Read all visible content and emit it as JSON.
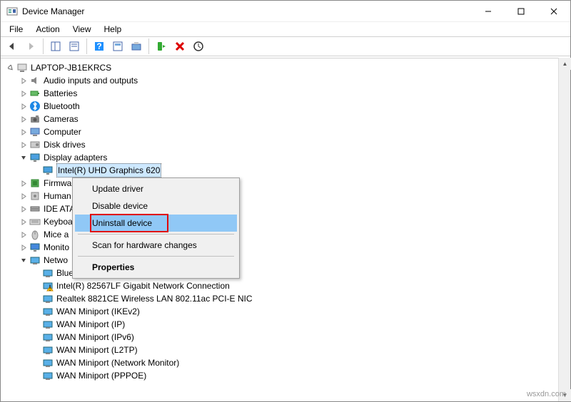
{
  "window": {
    "title": "Device Manager"
  },
  "menubar": [
    "File",
    "Action",
    "View",
    "Help"
  ],
  "tree": {
    "root": "LAPTOP-JB1EKRCS",
    "items": [
      {
        "label": "Audio inputs and outputs",
        "expand": "closed",
        "indent": 1,
        "icon": "audio"
      },
      {
        "label": "Batteries",
        "expand": "closed",
        "indent": 1,
        "icon": "battery"
      },
      {
        "label": "Bluetooth",
        "expand": "closed",
        "indent": 1,
        "icon": "bt"
      },
      {
        "label": "Cameras",
        "expand": "closed",
        "indent": 1,
        "icon": "camera"
      },
      {
        "label": "Computer",
        "expand": "closed",
        "indent": 1,
        "icon": "computer"
      },
      {
        "label": "Disk drives",
        "expand": "closed",
        "indent": 1,
        "icon": "disk"
      },
      {
        "label": "Display adapters",
        "expand": "open",
        "indent": 1,
        "icon": "display"
      },
      {
        "label": "Intel(R) UHD Graphics 620",
        "expand": "none",
        "indent": 2,
        "icon": "display",
        "sel": true
      },
      {
        "label": "Firmwa",
        "expand": "closed",
        "indent": 1,
        "icon": "firmware",
        "trunc": true
      },
      {
        "label": "Human",
        "expand": "closed",
        "indent": 1,
        "icon": "hid",
        "trunc": true
      },
      {
        "label": "IDE ATA",
        "expand": "closed",
        "indent": 1,
        "icon": "ide",
        "trunc": true
      },
      {
        "label": "Keyboa",
        "expand": "closed",
        "indent": 1,
        "icon": "keyboard",
        "trunc": true
      },
      {
        "label": "Mice a",
        "expand": "closed",
        "indent": 1,
        "icon": "mouse",
        "trunc": true
      },
      {
        "label": "Monito",
        "expand": "closed",
        "indent": 1,
        "icon": "monitor",
        "trunc": true
      },
      {
        "label": "Netwo",
        "expand": "open",
        "indent": 1,
        "icon": "net",
        "trunc": true
      },
      {
        "label": "Bluetooth Device (Personal Area Network)",
        "expand": "none",
        "indent": 2,
        "icon": "net"
      },
      {
        "label": "Intel(R) 82567LF Gigabit Network Connection",
        "expand": "none",
        "indent": 2,
        "icon": "net-warn"
      },
      {
        "label": "Realtek 8821CE Wireless LAN 802.11ac PCI-E NIC",
        "expand": "none",
        "indent": 2,
        "icon": "net"
      },
      {
        "label": "WAN Miniport (IKEv2)",
        "expand": "none",
        "indent": 2,
        "icon": "net"
      },
      {
        "label": "WAN Miniport (IP)",
        "expand": "none",
        "indent": 2,
        "icon": "net"
      },
      {
        "label": "WAN Miniport (IPv6)",
        "expand": "none",
        "indent": 2,
        "icon": "net"
      },
      {
        "label": "WAN Miniport (L2TP)",
        "expand": "none",
        "indent": 2,
        "icon": "net"
      },
      {
        "label": "WAN Miniport (Network Monitor)",
        "expand": "none",
        "indent": 2,
        "icon": "net"
      },
      {
        "label": "WAN Miniport (PPPOE)",
        "expand": "none",
        "indent": 2,
        "icon": "net"
      }
    ]
  },
  "contextmenu": {
    "items": [
      {
        "label": "Update driver",
        "type": "item"
      },
      {
        "label": "Disable device",
        "type": "item"
      },
      {
        "label": "Uninstall device",
        "type": "item",
        "sel": true,
        "highlight": true
      },
      {
        "type": "sep"
      },
      {
        "label": "Scan for hardware changes",
        "type": "item"
      },
      {
        "type": "sep"
      },
      {
        "label": "Properties",
        "type": "item",
        "bold": true
      }
    ]
  },
  "watermark": "wsxdn.com"
}
